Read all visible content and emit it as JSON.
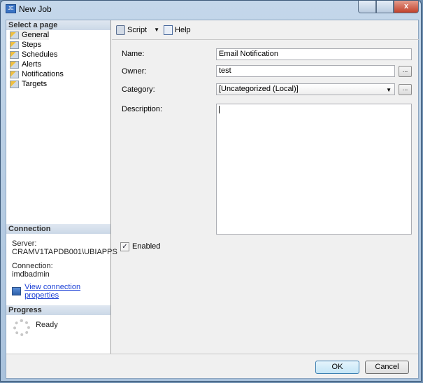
{
  "window": {
    "title": "New Job",
    "close": "x"
  },
  "left": {
    "select_header": "Select a page",
    "pages": [
      "General",
      "Steps",
      "Schedules",
      "Alerts",
      "Notifications",
      "Targets"
    ],
    "connection_header": "Connection",
    "server_label": "Server:",
    "server_value": "CRAMV1TAPDB001\\UBIAPPS",
    "connection_label": "Connection:",
    "connection_value": "imdbadmin",
    "view_props": "View connection properties",
    "progress_header": "Progress",
    "progress_status": "Ready"
  },
  "toolbar": {
    "script": "Script",
    "help": "Help"
  },
  "form": {
    "name_label": "Name:",
    "name_value": "Email Notification",
    "owner_label": "Owner:",
    "owner_value": "test",
    "category_label": "Category:",
    "category_value": "[Uncategorized (Local)]",
    "description_label": "Description:",
    "description_value": "",
    "browse": "...",
    "enabled_label": "Enabled",
    "enabled": true
  },
  "buttons": {
    "ok": "OK",
    "cancel": "Cancel"
  }
}
